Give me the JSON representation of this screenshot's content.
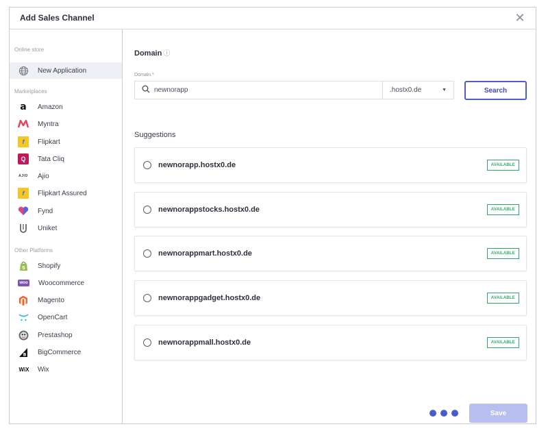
{
  "modal": {
    "title": "Add Sales Channel",
    "close_glyph": "✕"
  },
  "sidebar": {
    "sections": [
      {
        "title": "Online store",
        "items": [
          {
            "label": "New Application",
            "icon": "globe-icon",
            "active": true
          }
        ]
      },
      {
        "title": "Marketplaces",
        "items": [
          {
            "label": "Amazon",
            "icon": "amazon-icon",
            "glyph": "a",
            "color": "#111111"
          },
          {
            "label": "Myntra",
            "icon": "myntra-icon",
            "glyph": "M",
            "color": "#e7445a"
          },
          {
            "label": "Flipkart",
            "icon": "flipkart-icon",
            "glyph": "f",
            "color": "#f7c625"
          },
          {
            "label": "Tata Cliq",
            "icon": "tata-cliq-icon",
            "glyph": "Q",
            "color": "#c2185b"
          },
          {
            "label": "Ajio",
            "icon": "ajio-icon",
            "glyph": "AJIO",
            "color": "#333333"
          },
          {
            "label": "Flipkart Assured",
            "icon": "flipkart-assured-icon",
            "glyph": "f",
            "color": "#f7c625"
          },
          {
            "label": "Fynd",
            "icon": "fynd-icon",
            "glyph": "♥",
            "color": "#e0457b"
          },
          {
            "label": "Uniket",
            "icon": "uniket-icon",
            "glyph": "U",
            "color": "#555555"
          }
        ]
      },
      {
        "title": "Other Platforms",
        "items": [
          {
            "label": "Shopify",
            "icon": "shopify-icon",
            "glyph": "S",
            "color": "#95bf47"
          },
          {
            "label": "Woocommerce",
            "icon": "woocommerce-icon",
            "glyph": "woo",
            "color": "#7f54b3"
          },
          {
            "label": "Magento",
            "icon": "magento-icon",
            "glyph": "M",
            "color": "#ee672f"
          },
          {
            "label": "OpenCart",
            "icon": "opencart-icon",
            "glyph": "⌒",
            "color": "#28b6e9"
          },
          {
            "label": "Prestashop",
            "icon": "prestashop-icon",
            "glyph": "●",
            "color": "#6b6b6b"
          },
          {
            "label": "BigCommerce",
            "icon": "bigcommerce-icon",
            "glyph": "B",
            "color": "#121118"
          },
          {
            "label": "Wix",
            "icon": "wix-icon",
            "glyph": "WiX",
            "color": "#111111"
          }
        ]
      }
    ]
  },
  "domain": {
    "title": "Domain",
    "info_glyph": "ⓘ",
    "field_label": "Domain *",
    "input_value": "newnorapp",
    "tld_selected": ".hostx0.de",
    "search_label": "Search"
  },
  "suggestions": {
    "title": "Suggestions",
    "items": [
      {
        "name": "newnorapp.hostx0.de",
        "status": "AVAILABLE"
      },
      {
        "name": "newnorappstocks.hostx0.de",
        "status": "AVAILABLE"
      },
      {
        "name": "newnorappmart.hostx0.de",
        "status": "AVAILABLE"
      },
      {
        "name": "newnorappgadget.hostx0.de",
        "status": "AVAILABLE"
      },
      {
        "name": "newnorappmall.hostx0.de",
        "status": "AVAILABLE"
      }
    ]
  },
  "footer": {
    "save_label": "Save"
  },
  "colors": {
    "accent": "#4d5ccc",
    "available": "#2ca866",
    "save_disabled": "#b8bff0"
  }
}
